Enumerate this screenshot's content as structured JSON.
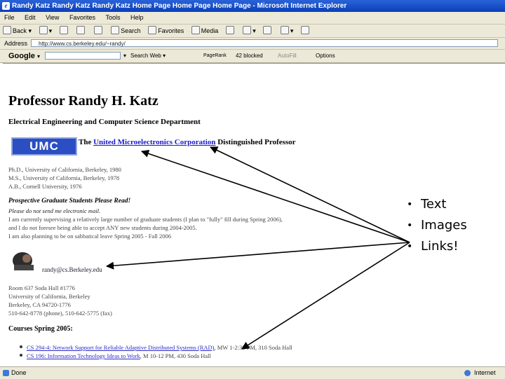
{
  "window": {
    "title": "Randy Katz Randy Katz Randy Katz Home Page Home Page Home Page - Microsoft Internet Explorer"
  },
  "menu": [
    "File",
    "Edit",
    "View",
    "Favorites",
    "Tools",
    "Help"
  ],
  "toolbar": {
    "back_label": "Back",
    "search_label": "Search",
    "favorites_label": "Favorites",
    "media_label": "Media"
  },
  "address": {
    "label": "Address",
    "url": "http://www.cs.berkeley.edu/~randy/"
  },
  "google_bar": {
    "logo": "Google",
    "search_web": "Search Web",
    "pagerank": "PageRank",
    "popups_blocked": "42 blocked",
    "autofill": "AutoFill",
    "options": "Options"
  },
  "page": {
    "heading": "Professor Randy H. Katz",
    "department": "Electrical Engineering and Computer Science Department",
    "umc_logo": "UMC",
    "umc_prefix": "The",
    "umc_link": "United Microelectronics Corporation",
    "umc_suffix": "Distinguished Professor",
    "degrees": [
      "Ph.D., University of California, Berkeley, 1980",
      "M.S., University of California, Berkeley, 1978",
      "A.B., Cornell University, 1976"
    ],
    "students_heading": "Prospective Graduate Students Please Read!",
    "students_sub": "Please do not send me electronic mail.",
    "students_lines": [
      "I am currently supervising a relatively large number of graduate students (I plan to \"fully\" fill during Spring 2006),",
      "and I do not foresee being able to accept ANY new students during 2004-2005.",
      "I am also planning to be on sabbatical leave Spring 2005 - Fall 2006"
    ],
    "email": "randy@cs.Berkeley.edu",
    "address_lines": [
      "Room 637 Soda Hall #1776",
      "University of California, Berkeley",
      "Berkeley, CA 94720-1776",
      "510-642-8778 (phone), 510-642-5775 (fax)"
    ],
    "courses_heading": "Courses Spring 2005:",
    "courses": [
      {
        "link": "CS 294-4: Network Support for Reliable Adaptive Distributed Systems (RAD)",
        "rest": ", MW 1-2:30 PM, 310 Soda Hall"
      },
      {
        "link": "CS 196: Information Technology Ideas to Work",
        "rest": ", M 10-12 PM, 430 Soda Hall"
      }
    ]
  },
  "status": {
    "left": "Done",
    "right": "Internet"
  },
  "slide_bullets": [
    "Text",
    "Images",
    "Links!"
  ]
}
